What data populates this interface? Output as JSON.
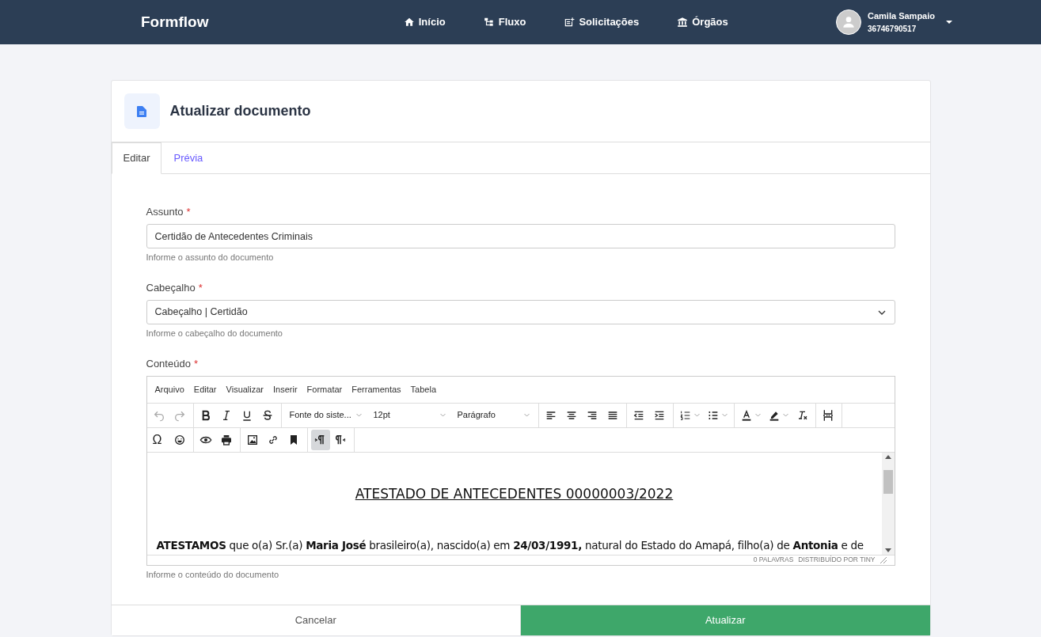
{
  "brand": "Formflow",
  "nav": [
    {
      "label": "Início",
      "kind": "home"
    },
    {
      "label": "Fluxo",
      "kind": "flow"
    },
    {
      "label": "Solicitações",
      "kind": "request"
    },
    {
      "label": "Órgãos",
      "kind": "building"
    }
  ],
  "user": {
    "name": "Camila Sampaio",
    "id": "36746790517"
  },
  "page_title": "Atualizar documento",
  "tabs": [
    {
      "label": "Editar",
      "selected": true
    },
    {
      "label": "Prévia",
      "selected": false
    }
  ],
  "fields": [
    {
      "kind": "input",
      "label": "Assunto",
      "required_mark": "*",
      "value": "Certidão de Antecedentes Criminais",
      "help": "Informe o assunto do documento"
    },
    {
      "kind": "select",
      "label": "Cabeçalho",
      "required_mark": "*",
      "value": "Cabeçalho | Certidão",
      "help": "Informe o cabeçalho do documento"
    }
  ],
  "editor": {
    "label": "Conteúdo",
    "required_mark": "*",
    "help": "Informe o conteúdo do documento",
    "menu": [
      "Arquivo",
      "Editar",
      "Visualizar",
      "Inserir",
      "Formatar",
      "Ferramentas",
      "Tabela"
    ],
    "toolbar_rows": [
      [
        [
          {
            "kind": "undo",
            "disabled": true
          },
          {
            "kind": "redo",
            "disabled": true
          }
        ],
        [
          {
            "kind": "bold"
          },
          {
            "kind": "italic"
          },
          {
            "kind": "underline"
          },
          {
            "kind": "strike"
          }
        ],
        [
          {
            "kind": "dropdown",
            "text": "Fonte do siste..."
          },
          {
            "kind": "dropdown",
            "text": "12pt"
          },
          {
            "kind": "dropdown",
            "text": "Parágrafo"
          }
        ],
        [
          {
            "kind": "align-left"
          },
          {
            "kind": "align-center"
          },
          {
            "kind": "align-right"
          },
          {
            "kind": "justify"
          }
        ],
        [
          {
            "kind": "outdent"
          },
          {
            "kind": "indent"
          }
        ],
        [
          {
            "kind": "numlist"
          },
          {
            "kind": "bullist"
          }
        ],
        [
          {
            "kind": "forecolor"
          },
          {
            "kind": "highlight"
          },
          {
            "kind": "clear"
          }
        ],
        [
          {
            "kind": "pagebreak"
          }
        ]
      ],
      [
        [
          {
            "kind": "symbol",
            "text": "Ω"
          },
          {
            "kind": "emoji"
          }
        ],
        [
          {
            "kind": "preview"
          },
          {
            "kind": "print"
          }
        ],
        [
          {
            "kind": "image"
          },
          {
            "kind": "link"
          },
          {
            "kind": "bookmark"
          }
        ],
        [
          {
            "kind": "ltr",
            "selected": true
          },
          {
            "kind": "rtl",
            "selected": false
          }
        ]
      ]
    ],
    "heading": "ATESTADO DE ANTECEDENTES 00000003/2022",
    "paragraph": "**ATESTAMOS** que o(a) Sr.(a) **Maria José** brasileiro(a), nascido(a) em **24/03/1991,** natural do Estado do Amapá, filho(a) de **Antonia** e de",
    "word_count": "0 PALAVRAS",
    "branding": "DISTRIBUÍDO POR TINY"
  },
  "buttons": [
    {
      "label": "Cancelar",
      "kind": "secondary"
    },
    {
      "label": "Atualizar",
      "kind": "primary"
    }
  ]
}
